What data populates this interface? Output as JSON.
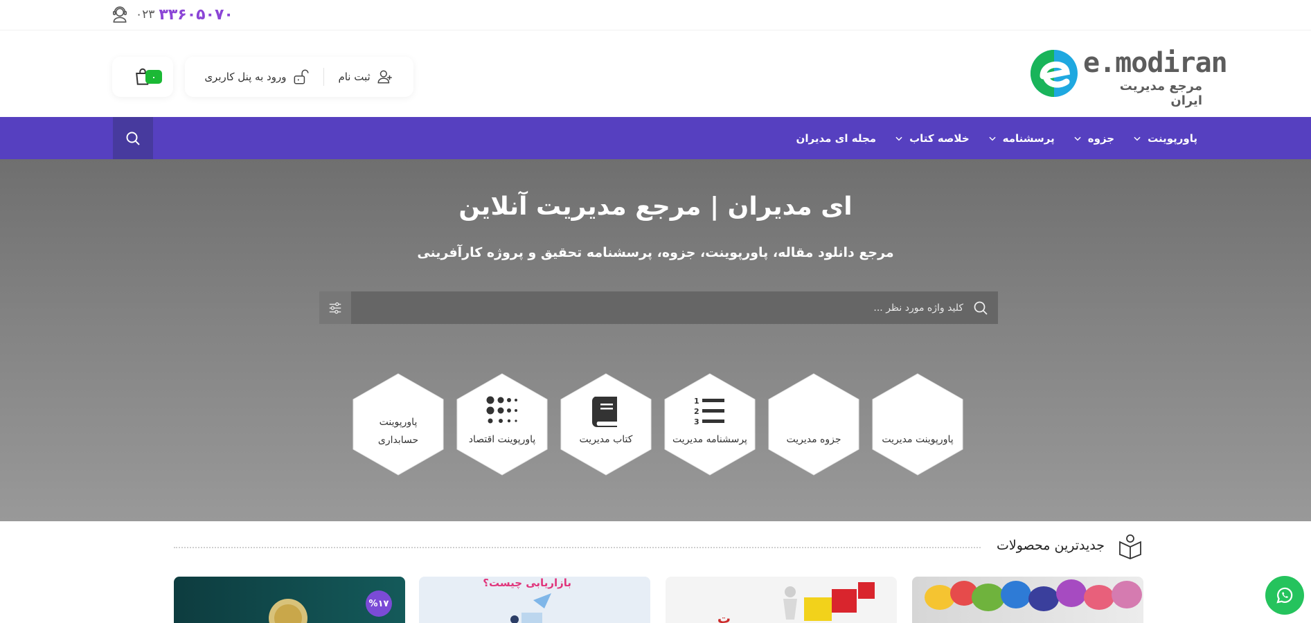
{
  "topbar": {
    "phone_code": "۰۲۳",
    "phone_number": "۳۳۶۰۵۰۷۰"
  },
  "header": {
    "logo_title": "e.modiran",
    "logo_subtitle": "مرجع مدیریت ایران",
    "register_label": "ثبت نام",
    "login_label": "ورود به پنل کاربری",
    "cart_count": "۰"
  },
  "nav": {
    "items": [
      {
        "label": "پاورپوینت",
        "has_dropdown": true
      },
      {
        "label": "جزوه",
        "has_dropdown": true
      },
      {
        "label": "پرسشنامه",
        "has_dropdown": true
      },
      {
        "label": "خلاصه کتاب",
        "has_dropdown": true
      },
      {
        "label": "مجله ای مدیران",
        "has_dropdown": false
      }
    ]
  },
  "hero": {
    "title": "ای مدیران | مرجع مدیریت آنلاین",
    "subtitle": "مرجع دانلود مقاله، پاورپوینت، جزوه، پرسشنامه تحقیق و پروژه کارآفرینی",
    "search_placeholder": "کلید واژه مورد نظر ..."
  },
  "categories": [
    {
      "label": "پاورپوینت مدیریت",
      "icon": "powerpoint-icon"
    },
    {
      "label": "جزوه مدیریت",
      "icon": "notes-icon"
    },
    {
      "label": "پرسشنامه مدیریت",
      "icon": "numbered-list-icon"
    },
    {
      "label": "کتاب مدیریت",
      "icon": "book-icon"
    },
    {
      "label": "پاورپوینت اقتصاد",
      "icon": "dots-grid-icon"
    },
    {
      "label_line1": "پاورپوینت",
      "label_line2": "حسابداری",
      "icon": "accounting-icon"
    }
  ],
  "products": {
    "section_title": "جدیدترین محصولات",
    "cards": [
      {
        "text": ""
      },
      {
        "text": "ت"
      },
      {
        "text": "بازاریابی چیست؟"
      },
      {
        "discount": "%۱۷"
      }
    ]
  },
  "colors": {
    "nav_bg": "#5640c0",
    "phone": "#8b45d6",
    "cart_badge": "#1bb935",
    "whatsapp": "#25c35d",
    "discount_badge": "#7b4bd6"
  }
}
